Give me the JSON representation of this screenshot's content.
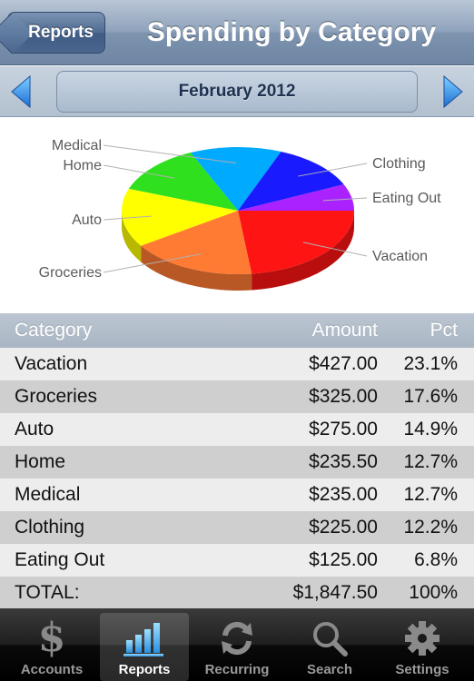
{
  "nav": {
    "back_label": "Reports",
    "title": "Spending by Category"
  },
  "month": {
    "label": "February 2012"
  },
  "chart_data": {
    "type": "pie",
    "categories": [
      "Vacation",
      "Groceries",
      "Auto",
      "Home",
      "Medical",
      "Clothing",
      "Eating Out"
    ],
    "values": [
      427.0,
      325.0,
      275.0,
      235.5,
      235.0,
      225.0,
      125.0
    ],
    "colors": [
      "#ff1414",
      "#ff7a33",
      "#ffff00",
      "#2fe01f",
      "#00aaff",
      "#1a1aff",
      "#aa22ff"
    ]
  },
  "table": {
    "headers": {
      "category": "Category",
      "amount": "Amount",
      "pct": "Pct"
    },
    "rows": [
      {
        "category": "Vacation",
        "amount": "$427.00",
        "pct": "23.1%"
      },
      {
        "category": "Groceries",
        "amount": "$325.00",
        "pct": "17.6%"
      },
      {
        "category": "Auto",
        "amount": "$275.00",
        "pct": "14.9%"
      },
      {
        "category": "Home",
        "amount": "$235.50",
        "pct": "12.7%"
      },
      {
        "category": "Medical",
        "amount": "$235.00",
        "pct": "12.7%"
      },
      {
        "category": "Clothing",
        "amount": "$225.00",
        "pct": "12.2%"
      },
      {
        "category": "Eating Out",
        "amount": "$125.00",
        "pct": "6.8%"
      }
    ],
    "total": {
      "category": "TOTAL:",
      "amount": "$1,847.50",
      "pct": "100%"
    }
  },
  "tabs": [
    {
      "label": "Accounts",
      "icon": "dollar-icon"
    },
    {
      "label": "Reports",
      "icon": "bar-chart-icon",
      "active": true
    },
    {
      "label": "Recurring",
      "icon": "recurring-icon"
    },
    {
      "label": "Search",
      "icon": "search-icon"
    },
    {
      "label": "Settings",
      "icon": "gear-icon"
    }
  ]
}
